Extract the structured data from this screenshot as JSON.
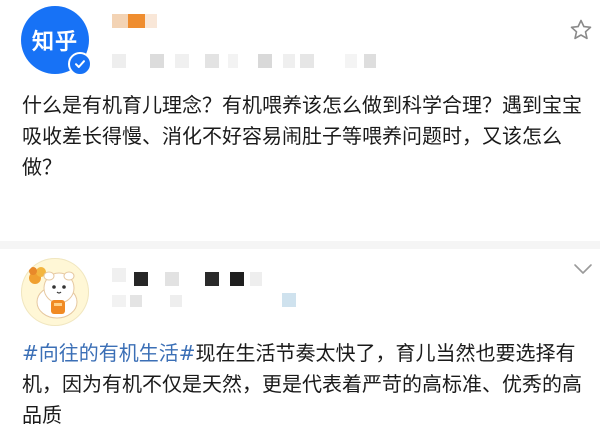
{
  "post1": {
    "avatar_text": "知乎",
    "icons": {
      "verify": "verified-check-icon",
      "star": "star-outline-icon"
    },
    "question_text": "什么是有机育儿理念？有机喂养该怎么做到科学合理？遇到宝宝吸收差长得慢、消化不好容易闹肚子等喂养问题时，又该怎么做？"
  },
  "post2": {
    "icons": {
      "chevron": "chevron-down-icon",
      "avatar": "cartoon-avatar"
    },
    "hashtag": "#向往的有机生活#",
    "text": "现在生活节奏太快了，育儿当然也要选择有机，因为有机不仅是天然，更是代表着严苛的高标准、优秀的高品质"
  },
  "colors": {
    "brand_blue": "#1772f6",
    "hashtag_blue": "#3b6fb6",
    "accent_orange": "#f08a24"
  }
}
